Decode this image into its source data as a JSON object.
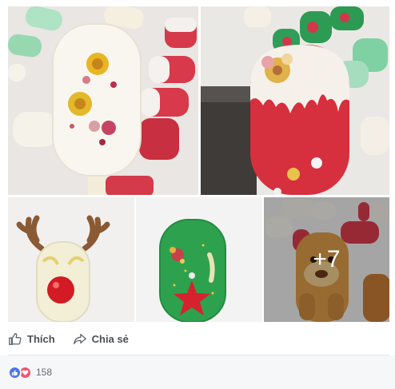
{
  "post": {
    "photos": [
      {
        "alt_icon": "white-popsicle-dried-flowers"
      },
      {
        "alt_icon": "red-white-popsicle-flower"
      },
      {
        "alt_icon": "reindeer-popsicle"
      },
      {
        "alt_icon": "green-christmas-popsicle"
      },
      {
        "alt_icon": "dog-popsicle"
      }
    ],
    "more_photos_label": "+7"
  },
  "actions": {
    "like_label": "Thích",
    "share_label": "Chia sẻ"
  },
  "reactions": {
    "count": "158",
    "like_color": "#4a76e8",
    "love_color": "#f2526b"
  }
}
